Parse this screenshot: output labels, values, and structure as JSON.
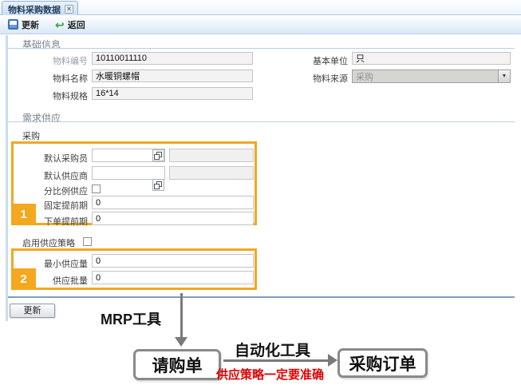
{
  "tab": {
    "title": "物料采购数据",
    "close_glyph": "×"
  },
  "toolbar": {
    "update_label": "更新",
    "back_label": "返回"
  },
  "sections": {
    "basic": "基础信息",
    "demand": "需求供应",
    "purchase_group": "采购"
  },
  "fields": {
    "material_no": {
      "label": "物料编号",
      "value": "10110011110"
    },
    "material_name": {
      "label": "物料名称",
      "value": "水暖铜螺帽"
    },
    "material_spec": {
      "label": "物料规格",
      "value": "16*14"
    },
    "base_unit": {
      "label": "基本单位",
      "value": "只"
    },
    "material_source": {
      "label": "物料来源",
      "value": "采购"
    },
    "default_buyer": {
      "label": "默认采购员",
      "value": ""
    },
    "default_supplier": {
      "label": "默认供应商",
      "value": ""
    },
    "ratio_supply": {
      "label": "分比例供应",
      "checked": false
    },
    "fixed_leadtime": {
      "label": "固定提前期",
      "value": "0"
    },
    "order_leadtime": {
      "label": "下单提前期",
      "value": "0"
    },
    "enable_supply_policy": {
      "label": "启用供应策略",
      "checked": false
    },
    "min_supply": {
      "label": "最小供应量",
      "value": "0"
    },
    "supply_batch": {
      "label": "供应批量",
      "value": "0"
    }
  },
  "badges": {
    "one": "1",
    "two": "2"
  },
  "footer": {
    "update_label": "更新"
  },
  "diagram": {
    "mrp_label": "MRP工具",
    "requisition_box": "请购单",
    "automation_label": "自动化工具",
    "warning_text": "供应策略一定要准确",
    "purchase_order_box": "采购订单"
  },
  "colors": {
    "highlight_orange": "#f3a81f",
    "warning_red": "#df0000",
    "arrow_gray": "#7a7a7a",
    "tab_blue_border": "#8fb4dc"
  },
  "dropdown_glyph": "▼"
}
